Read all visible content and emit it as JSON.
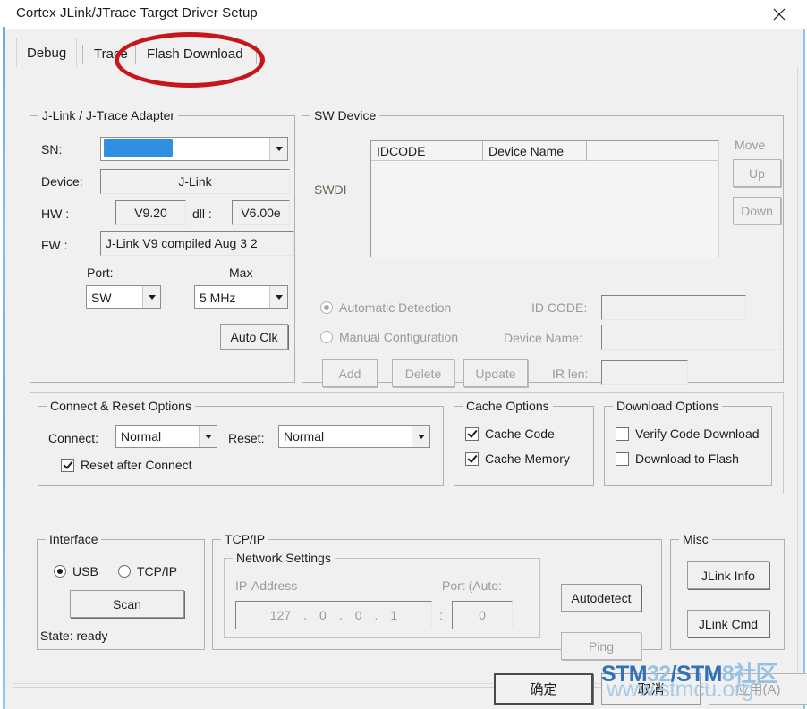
{
  "window": {
    "title": "Cortex JLink/JTrace Target Driver Setup",
    "close_icon": "close-icon"
  },
  "tabs": [
    {
      "label": "Debug",
      "selected": true
    },
    {
      "label": "Trace",
      "selected": false
    },
    {
      "label": "Flash Download",
      "selected": false
    }
  ],
  "annotation": {
    "shape": "red-ellipse",
    "targets_tab": "Flash Download"
  },
  "adapter": {
    "legend": "J-Link / J-Trace Adapter",
    "sn_label": "SN:",
    "sn_value": "",
    "sn_redacted": true,
    "device_label": "Device:",
    "device_value": "J-Link",
    "hw_label": "HW :",
    "hw_value": "V9.20",
    "dll_label": "dll :",
    "dll_value": "V6.00e",
    "fw_label": "FW :",
    "fw_value": "J-Link V9 compiled Aug  3 2",
    "port_label": "Port:",
    "port_value": "SW",
    "max_label": "Max",
    "max_value": "5 MHz",
    "auto_clk_label": "Auto Clk"
  },
  "sw_device": {
    "legend": "SW Device",
    "row_label": "SWDI",
    "columns": [
      "IDCODE",
      "Device Name",
      ""
    ],
    "rows": [],
    "move_label": "Move",
    "up_label": "Up",
    "down_label": "Down",
    "automatic_detection_label": "Automatic Detection",
    "manual_configuration_label": "Manual Configuration",
    "detection_mode": "automatic",
    "id_code_label": "ID CODE:",
    "id_code_value": "",
    "device_name_label": "Device Name:",
    "device_name_value": "",
    "ir_len_label": "IR len:",
    "ir_len_value": "",
    "add_label": "Add",
    "delete_label": "Delete",
    "update_label": "Update"
  },
  "connect_reset": {
    "legend": "Connect & Reset Options",
    "connect_label": "Connect:",
    "connect_value": "Normal",
    "reset_label": "Reset:",
    "reset_value": "Normal",
    "reset_after_connect_label": "Reset after Connect",
    "reset_after_connect_checked": true
  },
  "cache": {
    "legend": "Cache Options",
    "cache_code_label": "Cache Code",
    "cache_code_checked": true,
    "cache_memory_label": "Cache Memory",
    "cache_memory_checked": true
  },
  "download": {
    "legend": "Download Options",
    "verify_code_download_label": "Verify Code Download",
    "verify_code_download_checked": false,
    "download_to_flash_label": "Download to Flash",
    "download_to_flash_checked": false
  },
  "interface": {
    "legend": "Interface",
    "usb_label": "USB",
    "tcpip_label": "TCP/IP",
    "selected": "USB",
    "scan_label": "Scan",
    "state_label": "State: ready"
  },
  "tcpip": {
    "legend": "TCP/IP",
    "network_settings_legend": "Network Settings",
    "ip_address_label": "IP-Address",
    "ip_octets": [
      "127",
      "0",
      "0",
      "1"
    ],
    "ip_separator": ".",
    "port_label": "Port (Auto:",
    "port_colon": ":",
    "port_value": "0",
    "autodetect_label": "Autodetect",
    "ping_label": "Ping"
  },
  "misc": {
    "legend": "Misc",
    "jlink_info_label": "JLink Info",
    "jlink_cmd_label": "JLink Cmd"
  },
  "footer": {
    "ok_label": "确定",
    "cancel_label": "取消",
    "apply_label": "应用(A)"
  },
  "watermark": {
    "line1_part1": "STM",
    "line1_part2": "32",
    "line1_part3": "/STM",
    "line1_part4": "8社区",
    "line2": "www.stmcu.org",
    "color_dark": "#2f72b5",
    "color_light": "#96c2e4"
  }
}
